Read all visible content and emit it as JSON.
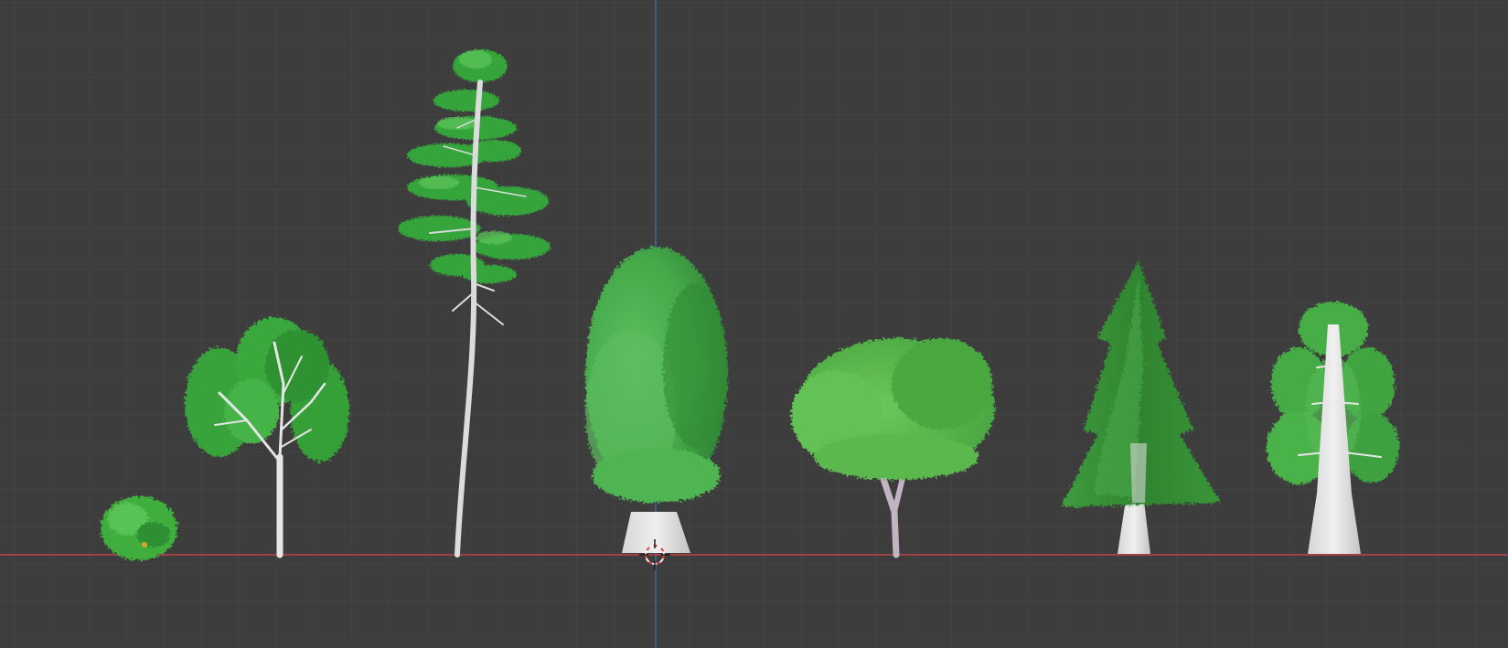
{
  "viewport": {
    "background_color": "#3d3d3d",
    "grid_minor_color": "#464646",
    "grid_major_color": "#4e4e4e",
    "x_axis_color": "#c0444c",
    "y_axis_color": "#4a76b8",
    "cursor_icon": "3d-cursor-icon",
    "objects": [
      {
        "name": "bush",
        "foliage_color": "#3fae3e"
      },
      {
        "name": "birch-tree",
        "foliage_color": "#3aa83c"
      },
      {
        "name": "tall-pine-tree",
        "foliage_color": "#35a33a"
      },
      {
        "name": "oak-tree-large",
        "foliage_color": "#48b04b"
      },
      {
        "name": "acacia-tree",
        "foliage_color": "#57b84a"
      },
      {
        "name": "fir-tree",
        "foliage_color": "#3a9b3a"
      },
      {
        "name": "sequoia-tree",
        "foliage_color": "#46ae46"
      }
    ]
  }
}
